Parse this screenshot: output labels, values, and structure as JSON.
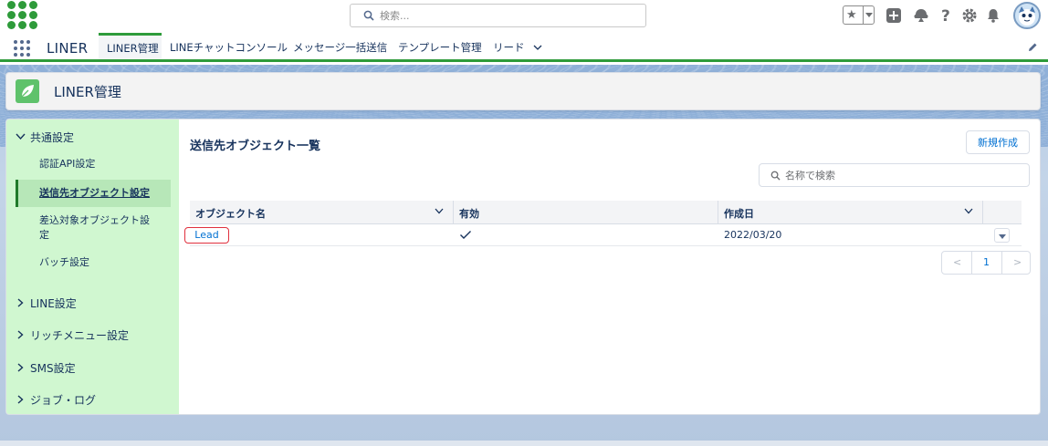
{
  "header": {
    "search_placeholder": "検索...",
    "colors": {
      "brand_green": "#2e9b3a",
      "link_blue": "#0070d2",
      "text_dark": "#16325c"
    },
    "icons": [
      "app-logo-icon",
      "search-icon",
      "favorites-star-icon",
      "favorites-dropdown-icon",
      "global-add-icon",
      "trailhead-icon",
      "help-icon",
      "setup-gear-icon",
      "notifications-bell-icon",
      "user-avatar"
    ]
  },
  "nav": {
    "app_name": "LINER",
    "tabs": [
      {
        "label": "LINER管理",
        "active": true
      },
      {
        "label": "LINEチャットコンソール",
        "active": false
      },
      {
        "label": "メッセージ一括送信",
        "active": false
      },
      {
        "label": "テンプレート管理",
        "active": false
      },
      {
        "label": "リード",
        "active": false
      }
    ]
  },
  "page_header": {
    "title": "LINER管理"
  },
  "sidebar": {
    "sections": [
      {
        "label": "共通設定",
        "expanded": true,
        "items": [
          {
            "label": "認証API設定",
            "selected": false
          },
          {
            "label": "送信先オブジェクト設定",
            "selected": true
          },
          {
            "label": "差込対象オブジェクト設定",
            "selected": false
          },
          {
            "label": "バッチ設定",
            "selected": false
          }
        ]
      },
      {
        "label": "LINE設定",
        "expanded": false
      },
      {
        "label": "リッチメニュー設定",
        "expanded": false
      },
      {
        "label": "SMS設定",
        "expanded": false
      },
      {
        "label": "ジョブ・ログ",
        "expanded": false
      }
    ]
  },
  "content": {
    "title": "送信先オブジェクト一覧",
    "new_button": "新規作成",
    "search_placeholder": "名称で検索",
    "table": {
      "columns": [
        "オブジェクト名",
        "有効",
        "作成日"
      ],
      "rows": [
        {
          "object_name": "Lead",
          "active": true,
          "created": "2022/03/20"
        }
      ]
    },
    "pager": {
      "prev": "<",
      "page": "1",
      "next": ">"
    }
  }
}
